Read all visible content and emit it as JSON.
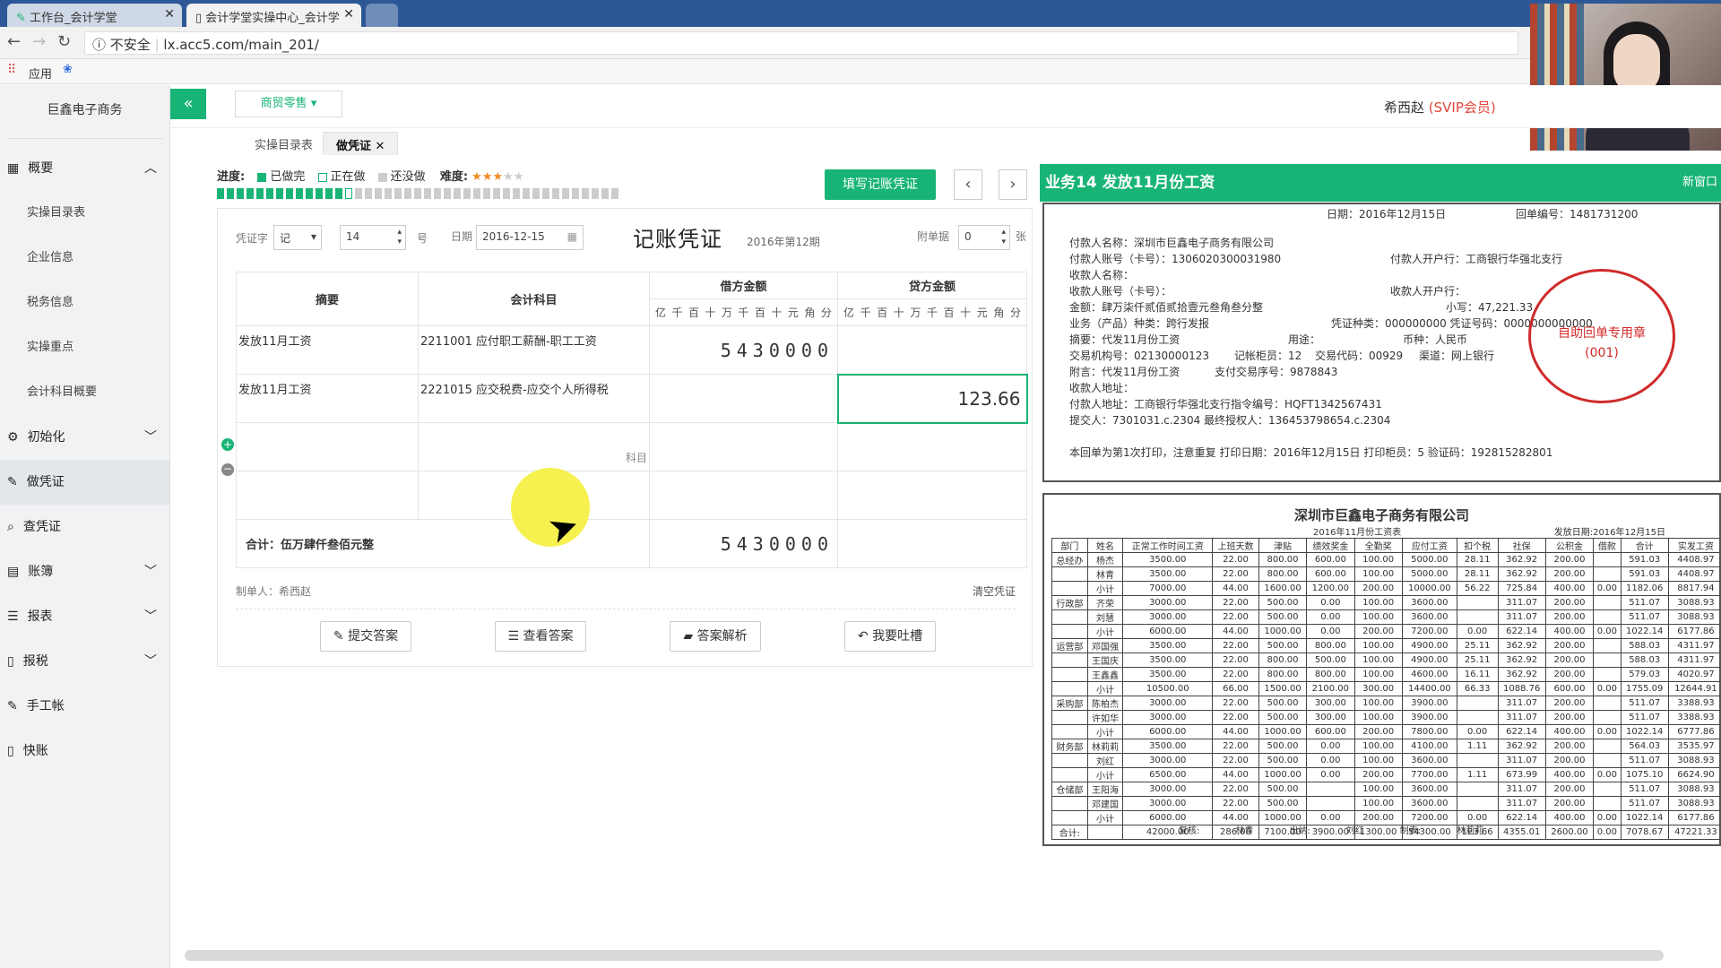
{
  "browser": {
    "tabs": [
      "工作台_会计学堂",
      "会计学堂实操中心_会计学"
    ],
    "insecure_label": "不安全",
    "url": "lx.acc5.com/main_201/",
    "bookmarks": {
      "apps_label": "应用"
    }
  },
  "sidebar": {
    "company": "巨鑫电子商务",
    "groups": [
      {
        "label": "概要",
        "icon": "grid-icon",
        "expanded": true,
        "items": [
          "实操目录表",
          "企业信息",
          "税务信息",
          "实操重点",
          "会计科目概要"
        ]
      },
      {
        "label": "初始化",
        "icon": "gear-icon"
      },
      {
        "label": "做凭证",
        "icon": "pencil-icon",
        "active": true
      },
      {
        "label": "查凭证",
        "icon": "search-icon"
      },
      {
        "label": "账簿",
        "icon": "book-icon"
      },
      {
        "label": "报表",
        "icon": "list-icon"
      },
      {
        "label": "报税",
        "icon": "document-icon"
      },
      {
        "label": "手工帐",
        "icon": "pencil-icon"
      },
      {
        "label": "快账",
        "icon": "document-icon"
      }
    ]
  },
  "topbar": {
    "industry": "商贸零售",
    "user_name": "希西赵",
    "user_badge": "(SVIP会员)"
  },
  "page_tabs": [
    "实操目录表",
    "做凭证"
  ],
  "progress": {
    "label": "进度:",
    "done": "已做完",
    "doing": "正在做",
    "todo": "还没做",
    "difficulty_label": "难度:",
    "difficulty_stars": 3,
    "difficulty_max": 5,
    "completed_tasks": 13,
    "total_tasks": 41
  },
  "colors": {
    "accent": "#18b476",
    "vip": "#e0463a",
    "stamp": "#d02a2a"
  },
  "fill_button": "填写记账凭证",
  "voucher": {
    "type_label": "凭证字",
    "type_value": "记",
    "number": "14",
    "number_suffix": "号",
    "date_label": "日期",
    "date": "2016-12-15",
    "title": "记账凭证",
    "period": "2016年第12期",
    "attach_label": "附单据",
    "attach_count": "0",
    "attach_suffix": "张",
    "headers": {
      "summary": "摘要",
      "account": "会计科目",
      "debit": "借方金额",
      "credit": "贷方金额"
    },
    "digit_labels": [
      "亿",
      "千",
      "百",
      "十",
      "万",
      "千",
      "百",
      "十",
      "元",
      "角",
      "分"
    ],
    "rows": [
      {
        "summary": "发放11月工资",
        "account": "2211001 应付职工薪酬-职工工资",
        "debit": "5430000",
        "credit": ""
      },
      {
        "summary": "发放11月工资",
        "account": "2221015 应交税费-应交个人所得税",
        "debit": "",
        "credit": "123.66"
      },
      {
        "summary": "",
        "account": "",
        "debit": "",
        "credit": "",
        "hint": "科目"
      },
      {
        "summary": "",
        "account": "",
        "debit": "",
        "credit": ""
      }
    ],
    "total_label": "合计：伍万肆仟叁佰元整",
    "total_debit": "5430000",
    "maker": "制单人：希西赵",
    "clear": "清空凭证"
  },
  "actions": [
    "提交答案",
    "查看答案",
    "答案解析",
    "我要吐槽"
  ],
  "task": {
    "title": "业务14 发放11月份工资",
    "new_window": "新窗口"
  },
  "receipt": {
    "date": "日期：2016年12月15日",
    "receipt_no": "回单编号：1481731200",
    "payer_name": "付款人名称：深圳市巨鑫电子商务有限公司",
    "payer_account": "付款人账号（卡号）：1306020300031980",
    "payer_bank": "付款人开户行：工商银行华强北支行",
    "payee_name": "收款人名称：",
    "payee_account": "收款人账号（卡号）：",
    "payee_bank": "收款人开户行：",
    "amount_words": "金额：肆万柒仟贰佰贰拾壹元叁角叁分整",
    "amount_small": "小写：47,221.33",
    "business": "业务（产品）种类：跨行发报",
    "voucher_kind": "凭证种类：000000000 凭证号码：0000000000000",
    "summary": "摘要：代发11月份工资",
    "purpose": "用途：",
    "currency": "币种：人民币",
    "org": "交易机构号：02130000123",
    "teller": "记帐柜员：12",
    "code": "交易代码：00929",
    "channel": "渠道：网上银行",
    "note": "附言：代发11月份工资",
    "pay_seq": "支付交易序号：9878843",
    "payee_addr": "收款人地址：",
    "payer_addr": "付款人地址：工商银行华强北支行指令编号：HQFT1342567431",
    "submitter": "提交人：7301031.c.2304 最终授权人：136453798654.c.2304",
    "footer": "本回单为第1次打印，注意重复  打印日期：2016年12月15日  打印柜员：5  验证码：192815282801",
    "stamp_text": "(001)",
    "stamp_line": "自助回单专用章"
  },
  "payroll": {
    "title": "深圳市巨鑫电子商务有限公司",
    "subtitle": "2016年11月份工资表",
    "pay_date": "发放日期:2016年12月15日",
    "headers": [
      "部门",
      "姓名",
      "正常工作时间工资",
      "上班天数",
      "津贴",
      "绩效奖金",
      "全勤奖",
      "应付工资",
      "扣个税",
      "社保",
      "公积金",
      "借款",
      "合计",
      "实发工资"
    ],
    "rows": [
      [
        "总经办",
        "杨杰",
        "3500.00",
        "22.00",
        "800.00",
        "600.00",
        "100.00",
        "5000.00",
        "28.11",
        "362.92",
        "200.00",
        "",
        "591.03",
        "4408.97"
      ],
      [
        "",
        "林青",
        "3500.00",
        "22.00",
        "800.00",
        "600.00",
        "100.00",
        "5000.00",
        "28.11",
        "362.92",
        "200.00",
        "",
        "591.03",
        "4408.97"
      ],
      [
        "",
        "小计",
        "7000.00",
        "44.00",
        "1600.00",
        "1200.00",
        "200.00",
        "10000.00",
        "56.22",
        "725.84",
        "400.00",
        "0.00",
        "1182.06",
        "8817.94"
      ],
      [
        "行政部",
        "齐荣",
        "3000.00",
        "22.00",
        "500.00",
        "0.00",
        "100.00",
        "3600.00",
        "",
        "311.07",
        "200.00",
        "",
        "511.07",
        "3088.93"
      ],
      [
        "",
        "刘慧",
        "3000.00",
        "22.00",
        "500.00",
        "0.00",
        "100.00",
        "3600.00",
        "",
        "311.07",
        "200.00",
        "",
        "511.07",
        "3088.93"
      ],
      [
        "",
        "小计",
        "6000.00",
        "44.00",
        "1000.00",
        "0.00",
        "200.00",
        "7200.00",
        "0.00",
        "622.14",
        "400.00",
        "0.00",
        "1022.14",
        "6177.86"
      ],
      [
        "运营部",
        "邓国强",
        "3500.00",
        "22.00",
        "500.00",
        "800.00",
        "100.00",
        "4900.00",
        "25.11",
        "362.92",
        "200.00",
        "",
        "588.03",
        "4311.97"
      ],
      [
        "",
        "王国庆",
        "3500.00",
        "22.00",
        "800.00",
        "500.00",
        "100.00",
        "4900.00",
        "25.11",
        "362.92",
        "200.00",
        "",
        "588.03",
        "4311.97"
      ],
      [
        "",
        "王鑫鑫",
        "3500.00",
        "22.00",
        "800.00",
        "800.00",
        "100.00",
        "4600.00",
        "16.11",
        "362.92",
        "200.00",
        "",
        "579.03",
        "4020.97"
      ],
      [
        "",
        "小计",
        "10500.00",
        "66.00",
        "1500.00",
        "2100.00",
        "300.00",
        "14400.00",
        "66.33",
        "1088.76",
        "600.00",
        "0.00",
        "1755.09",
        "12644.91"
      ],
      [
        "采购部",
        "陈柏杰",
        "3000.00",
        "22.00",
        "500.00",
        "300.00",
        "100.00",
        "3900.00",
        "",
        "311.07",
        "200.00",
        "",
        "511.07",
        "3388.93"
      ],
      [
        "",
        "许如华",
        "3000.00",
        "22.00",
        "500.00",
        "300.00",
        "100.00",
        "3900.00",
        "",
        "311.07",
        "200.00",
        "",
        "511.07",
        "3388.93"
      ],
      [
        "",
        "小计",
        "6000.00",
        "44.00",
        "1000.00",
        "600.00",
        "200.00",
        "7800.00",
        "0.00",
        "622.14",
        "400.00",
        "0.00",
        "1022.14",
        "6777.86"
      ],
      [
        "财务部",
        "林莉莉",
        "3500.00",
        "22.00",
        "500.00",
        "0.00",
        "100.00",
        "4100.00",
        "1.11",
        "362.92",
        "200.00",
        "",
        "564.03",
        "3535.97"
      ],
      [
        "",
        "刘红",
        "3000.00",
        "22.00",
        "500.00",
        "0.00",
        "100.00",
        "3600.00",
        "",
        "311.07",
        "200.00",
        "",
        "511.07",
        "3088.93"
      ],
      [
        "",
        "小计",
        "6500.00",
        "44.00",
        "1000.00",
        "0.00",
        "200.00",
        "7700.00",
        "1.11",
        "673.99",
        "400.00",
        "0.00",
        "1075.10",
        "6624.90"
      ],
      [
        "仓储部",
        "王阳海",
        "3000.00",
        "22.00",
        "500.00",
        "",
        "100.00",
        "3600.00",
        "",
        "311.07",
        "200.00",
        "",
        "511.07",
        "3088.93"
      ],
      [
        "",
        "邓建国",
        "3000.00",
        "22.00",
        "500.00",
        "",
        "100.00",
        "3600.00",
        "",
        "311.07",
        "200.00",
        "",
        "511.07",
        "3088.93"
      ],
      [
        "",
        "小计",
        "6000.00",
        "44.00",
        "1000.00",
        "0.00",
        "200.00",
        "7200.00",
        "0.00",
        "622.14",
        "400.00",
        "0.00",
        "1022.14",
        "6177.86"
      ],
      [
        "合计:",
        "",
        "42000.00",
        "286.00",
        "7100.00",
        "3900.00",
        "1300.00",
        "54300.00",
        "123.66",
        "4355.01",
        "2600.00",
        "0.00",
        "7078.67",
        "47221.33"
      ]
    ],
    "footer": [
      "复核:",
      "林青",
      "出纳:",
      "刘红",
      "制表:",
      "林莉莉"
    ]
  }
}
